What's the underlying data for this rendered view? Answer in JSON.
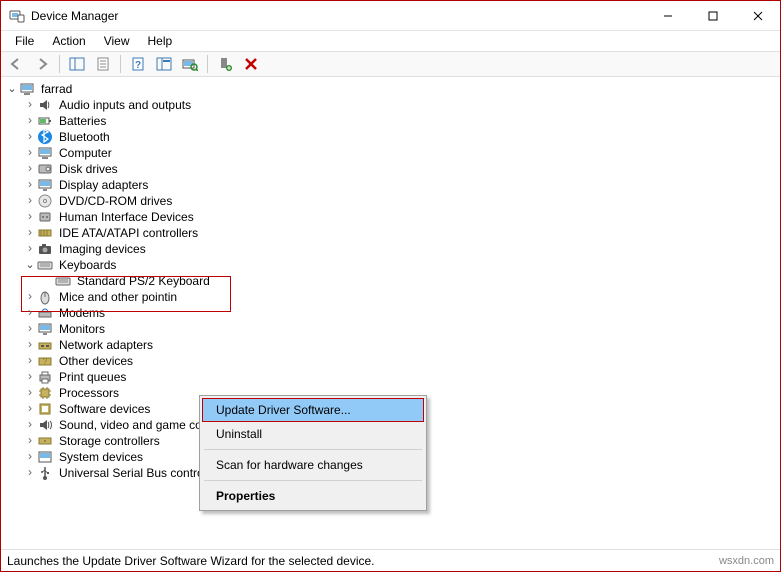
{
  "window": {
    "title": "Device Manager"
  },
  "menubar": {
    "file": "File",
    "action": "Action",
    "view": "View",
    "help": "Help"
  },
  "tree": {
    "root": "farrad",
    "items": [
      "Audio inputs and outputs",
      "Batteries",
      "Bluetooth",
      "Computer",
      "Disk drives",
      "Display adapters",
      "DVD/CD-ROM drives",
      "Human Interface Devices",
      "IDE ATA/ATAPI controllers",
      "Imaging devices",
      "Keyboards",
      "Mice and other pointin",
      "Modems",
      "Monitors",
      "Network adapters",
      "Other devices",
      "Print queues",
      "Processors",
      "Software devices",
      "Sound, video and game controllers",
      "Storage controllers",
      "System devices",
      "Universal Serial Bus controllers"
    ],
    "keyboard_child": "Standard PS/2 Keyboard"
  },
  "context_menu": {
    "update": "Update Driver Software...",
    "uninstall": "Uninstall",
    "scan": "Scan for hardware changes",
    "properties": "Properties"
  },
  "statusbar": {
    "text": "Launches the Update Driver Software Wizard for the selected device."
  },
  "watermark": "wsxdn.com"
}
